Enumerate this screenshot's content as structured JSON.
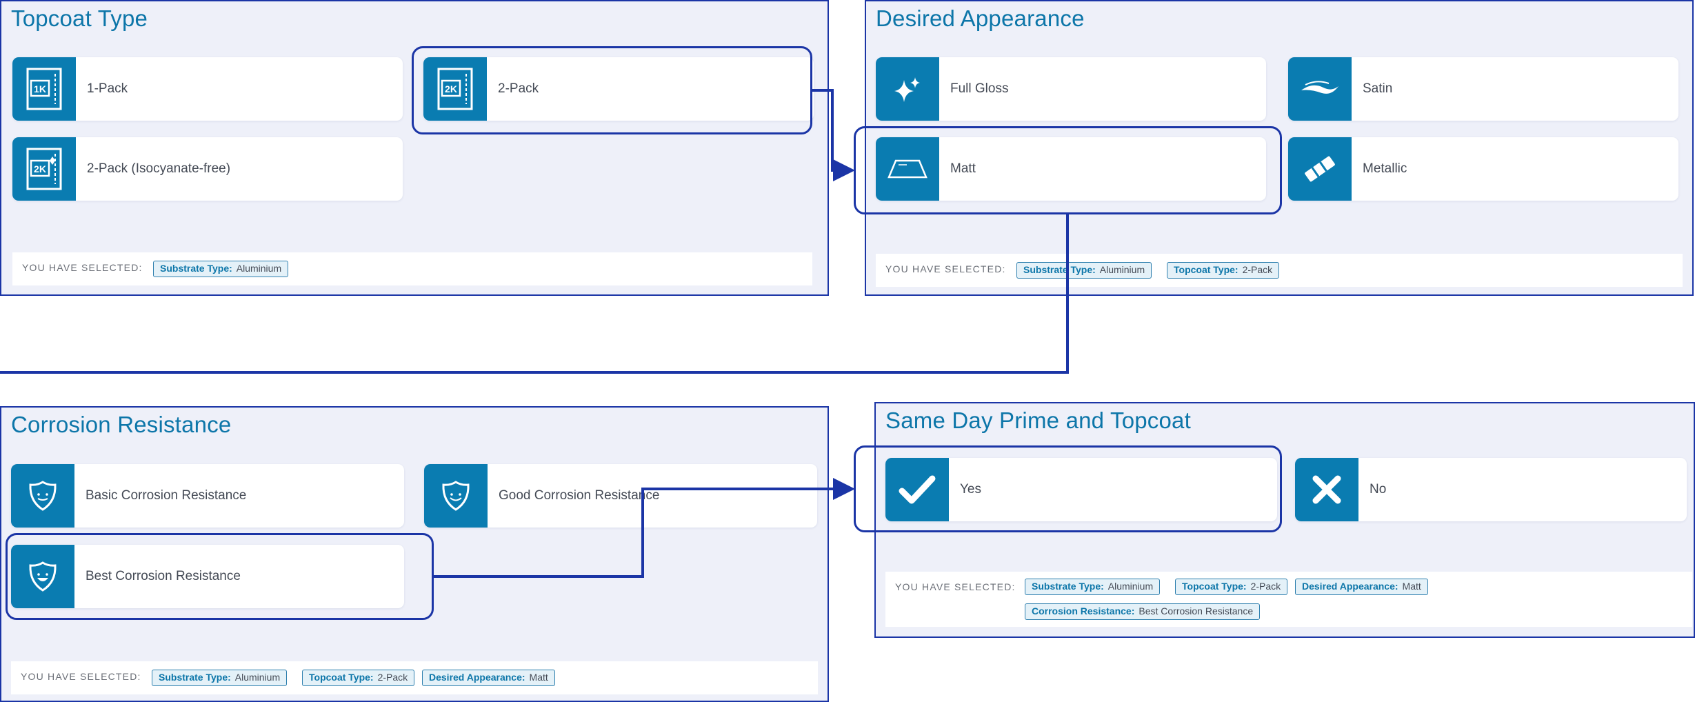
{
  "selected_label": "YOU HAVE SELECTED:",
  "topcoat": {
    "title": "Topcoat Type",
    "options": [
      {
        "label": "1-Pack",
        "icon": "1k-pack-icon"
      },
      {
        "label": "2-Pack",
        "icon": "2k-pack-icon"
      },
      {
        "label": "2-Pack (Isocyanate-free)",
        "icon": "2k-isocyanate-free-icon"
      }
    ],
    "chips": [
      {
        "key": "Substrate Type:",
        "value": "Aluminium"
      }
    ]
  },
  "appearance": {
    "title": "Desired Appearance",
    "options": [
      {
        "label": "Full Gloss",
        "icon": "sparkle-icon"
      },
      {
        "label": "Satin",
        "icon": "satin-wave-icon"
      },
      {
        "label": "Matt",
        "icon": "matt-surface-icon"
      },
      {
        "label": "Metallic",
        "icon": "metallic-bar-icon"
      }
    ],
    "chips": [
      {
        "key": "Substrate Type:",
        "value": "Aluminium"
      },
      {
        "key": "Topcoat Type:",
        "value": "2-Pack"
      }
    ]
  },
  "corrosion": {
    "title": "Corrosion Resistance",
    "options": [
      {
        "label": "Basic Corrosion Resistance",
        "icon": "shield-basic-icon"
      },
      {
        "label": "Good Corrosion Resistance",
        "icon": "shield-good-icon"
      },
      {
        "label": "Best Corrosion Resistance",
        "icon": "shield-best-icon"
      }
    ],
    "chips": [
      {
        "key": "Substrate Type:",
        "value": "Aluminium"
      },
      {
        "key": "Topcoat Type:",
        "value": "2-Pack"
      },
      {
        "key": "Desired Appearance:",
        "value": "Matt"
      }
    ]
  },
  "sameday": {
    "title": "Same Day Prime and Topcoat",
    "options": [
      {
        "label": "Yes",
        "icon": "checkmark-icon"
      },
      {
        "label": "No",
        "icon": "cross-icon"
      }
    ],
    "chips": [
      {
        "key": "Substrate Type:",
        "value": "Aluminium"
      },
      {
        "key": "Topcoat Type:",
        "value": "2-Pack"
      },
      {
        "key": "Desired Appearance:",
        "value": "Matt"
      },
      {
        "key": "Corrosion Resistance:",
        "value": "Best Corrosion Resistance"
      }
    ]
  },
  "colors": {
    "accent": "#0a7cb1",
    "title": "#0d76a9",
    "flow_line": "#1b35a6",
    "panel_bg": "#eef0f9"
  }
}
